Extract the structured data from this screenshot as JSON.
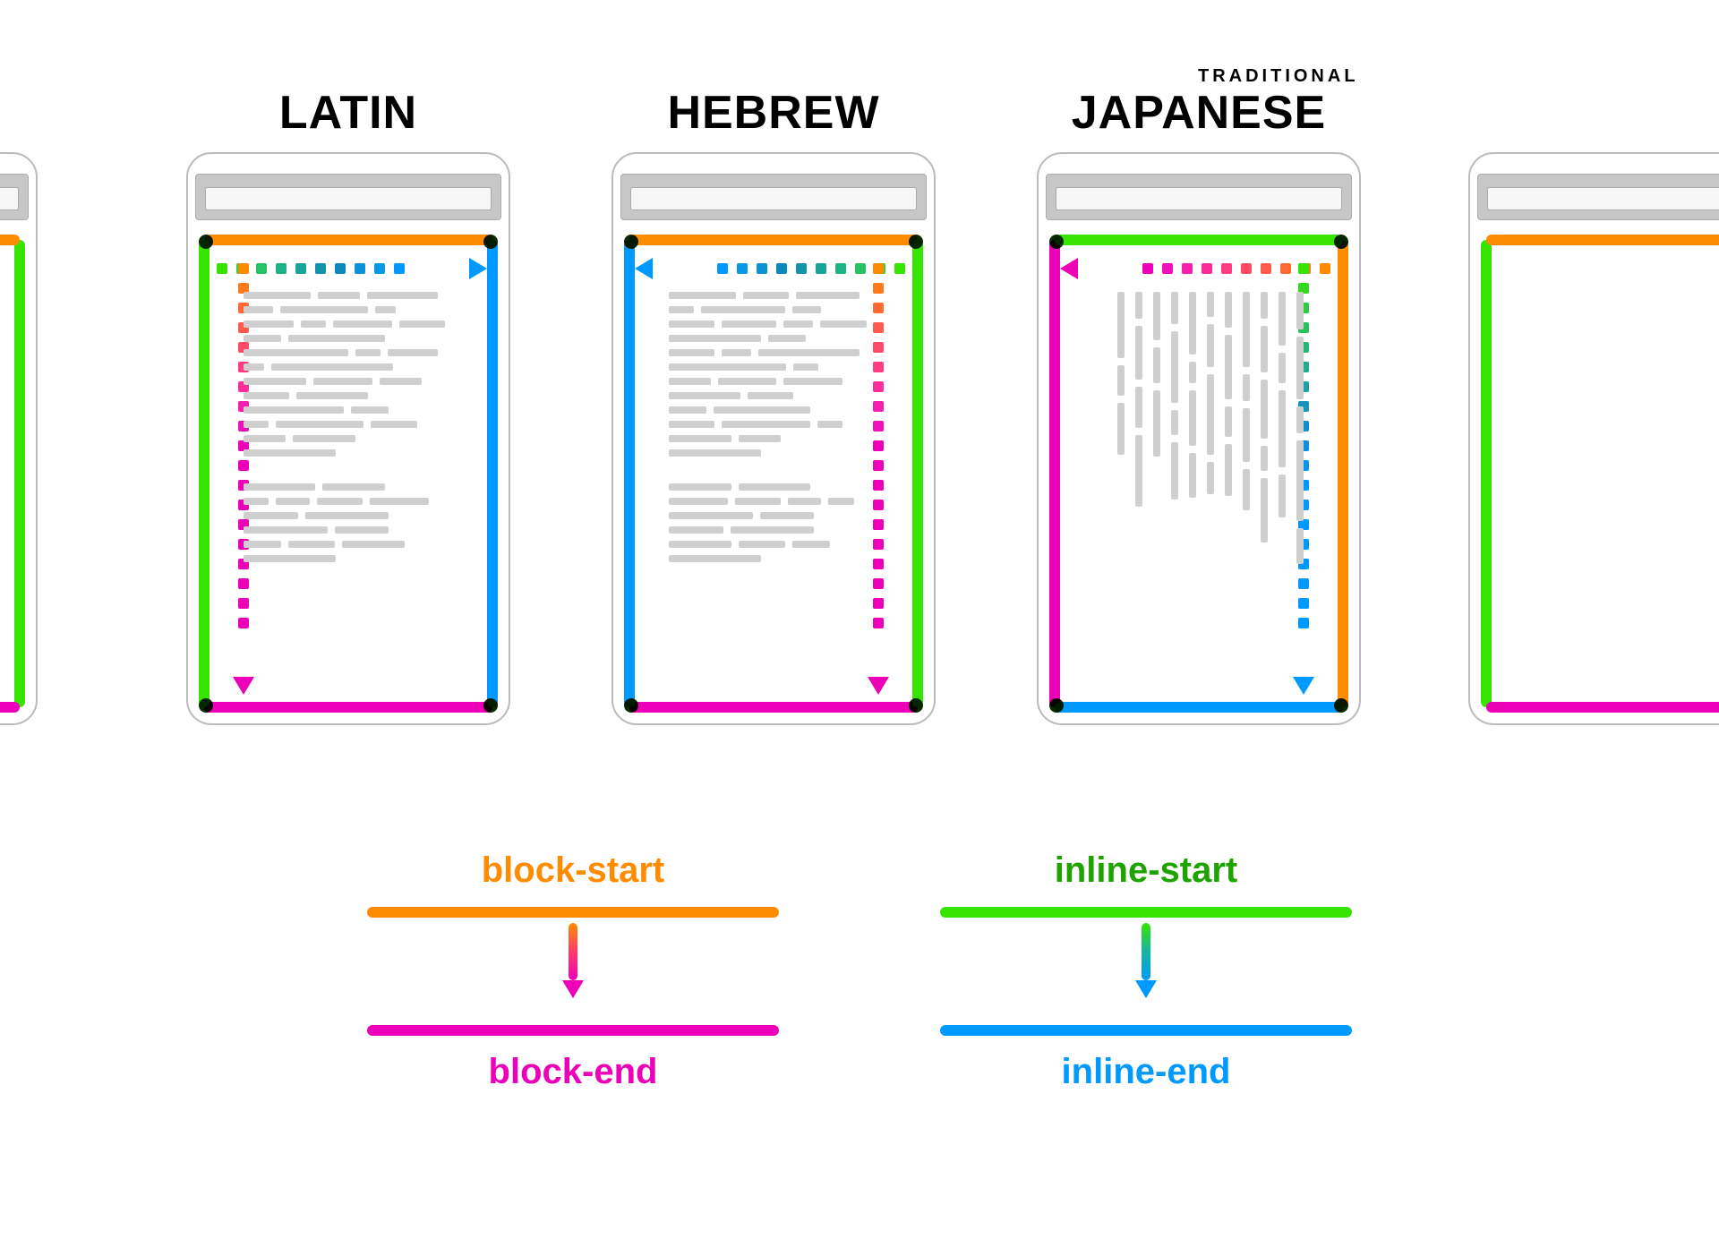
{
  "titles": {
    "latin": "LATIN",
    "hebrew": "HEBREW",
    "japanese": "JAPANESE",
    "japanese_sub": "TRADITIONAL"
  },
  "legend": {
    "block_start": "block-start",
    "block_end": "block-end",
    "inline_start": "inline-start",
    "inline_end": "inline-end"
  },
  "colors": {
    "block_start": "#ff8c00",
    "block_end": "#ec00b8",
    "inline_start": "#37e400",
    "inline_end": "#0099ff"
  },
  "layouts": {
    "latin": {
      "block_flow": "top-to-bottom",
      "inline_flow": "left-to-right",
      "edges": {
        "block_start": "top",
        "block_end": "bottom",
        "inline_start": "left",
        "inline_end": "right"
      }
    },
    "hebrew": {
      "block_flow": "top-to-bottom",
      "inline_flow": "right-to-left",
      "edges": {
        "block_start": "top",
        "block_end": "bottom",
        "inline_start": "right",
        "inline_end": "left"
      }
    },
    "japanese_traditional": {
      "block_flow": "right-to-left",
      "inline_flow": "top-to-bottom",
      "edges": {
        "block_start": "right",
        "block_end": "left",
        "inline_start": "top",
        "inline_end": "bottom"
      }
    }
  }
}
